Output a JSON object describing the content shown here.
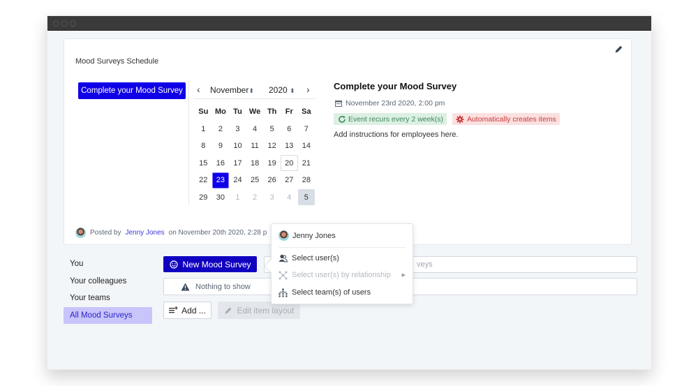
{
  "window": {
    "controls": [
      "close",
      "minimize",
      "maximize"
    ]
  },
  "schedule": {
    "title": "Mood Surveys Schedule",
    "edit_icon": "pencil-icon",
    "event_button": "Complete your Mood Survey",
    "calendar": {
      "month": "November",
      "year": "2020",
      "prev_icon": "chevron-left-icon",
      "next_icon": "chevron-right-icon",
      "weekdays": [
        "Su",
        "Mo",
        "Tu",
        "We",
        "Th",
        "Fr",
        "Sa"
      ],
      "weeks": [
        [
          {
            "d": "1"
          },
          {
            "d": "2"
          },
          {
            "d": "3"
          },
          {
            "d": "4"
          },
          {
            "d": "5"
          },
          {
            "d": "6"
          },
          {
            "d": "7"
          }
        ],
        [
          {
            "d": "8"
          },
          {
            "d": "9"
          },
          {
            "d": "10"
          },
          {
            "d": "11"
          },
          {
            "d": "12"
          },
          {
            "d": "13"
          },
          {
            "d": "14"
          }
        ],
        [
          {
            "d": "15"
          },
          {
            "d": "16"
          },
          {
            "d": "17"
          },
          {
            "d": "18"
          },
          {
            "d": "19"
          },
          {
            "d": "20",
            "state": "today"
          },
          {
            "d": "21"
          }
        ],
        [
          {
            "d": "22"
          },
          {
            "d": "23",
            "state": "selected"
          },
          {
            "d": "24"
          },
          {
            "d": "25"
          },
          {
            "d": "26"
          },
          {
            "d": "27"
          },
          {
            "d": "28"
          }
        ],
        [
          {
            "d": "29"
          },
          {
            "d": "30"
          },
          {
            "d": "1",
            "state": "other"
          },
          {
            "d": "2",
            "state": "other"
          },
          {
            "d": "3",
            "state": "other"
          },
          {
            "d": "4",
            "state": "other"
          },
          {
            "d": "5",
            "state": "highlight"
          }
        ]
      ]
    },
    "event": {
      "title": "Complete your Mood Survey",
      "date": "November 23rd 2020, 2:00 pm",
      "recurrence_badge": "Event recurs every 2 week(s)",
      "auto_badge": "Automatically creates items",
      "description": "Add instructions for employees here."
    },
    "posted": {
      "prefix": "Posted by",
      "author": "Jenny Jones",
      "suffix": "on November 20th 2020, 2:28 p"
    }
  },
  "sidebar": {
    "items": [
      {
        "label": "You"
      },
      {
        "label": "Your colleagues"
      },
      {
        "label": "Your teams"
      },
      {
        "label": "All Mood Surveys",
        "active": true
      }
    ]
  },
  "toolbar": {
    "new_button": "New Mood Survey",
    "search_placeholder_visible": "veys",
    "empty_message": "Nothing to show",
    "add_button": "Add ...",
    "edit_layout_button": "Edit item layout"
  },
  "popover": {
    "user": "Jenny Jones",
    "items": [
      {
        "label": "Select user(s)",
        "icon": "users-icon",
        "disabled": false
      },
      {
        "label": "Select user(s) by relationship",
        "icon": "relationship-icon",
        "disabled": true,
        "submenu": true
      },
      {
        "label": "Select team(s) of users",
        "icon": "org-chart-icon",
        "disabled": false
      }
    ]
  },
  "colors": {
    "accent": "#1000e8",
    "accent_dark": "#1000c0",
    "active_bg": "#c8c5fb",
    "success_bg": "#dcefe3",
    "danger_bg": "#fbe0e0"
  }
}
